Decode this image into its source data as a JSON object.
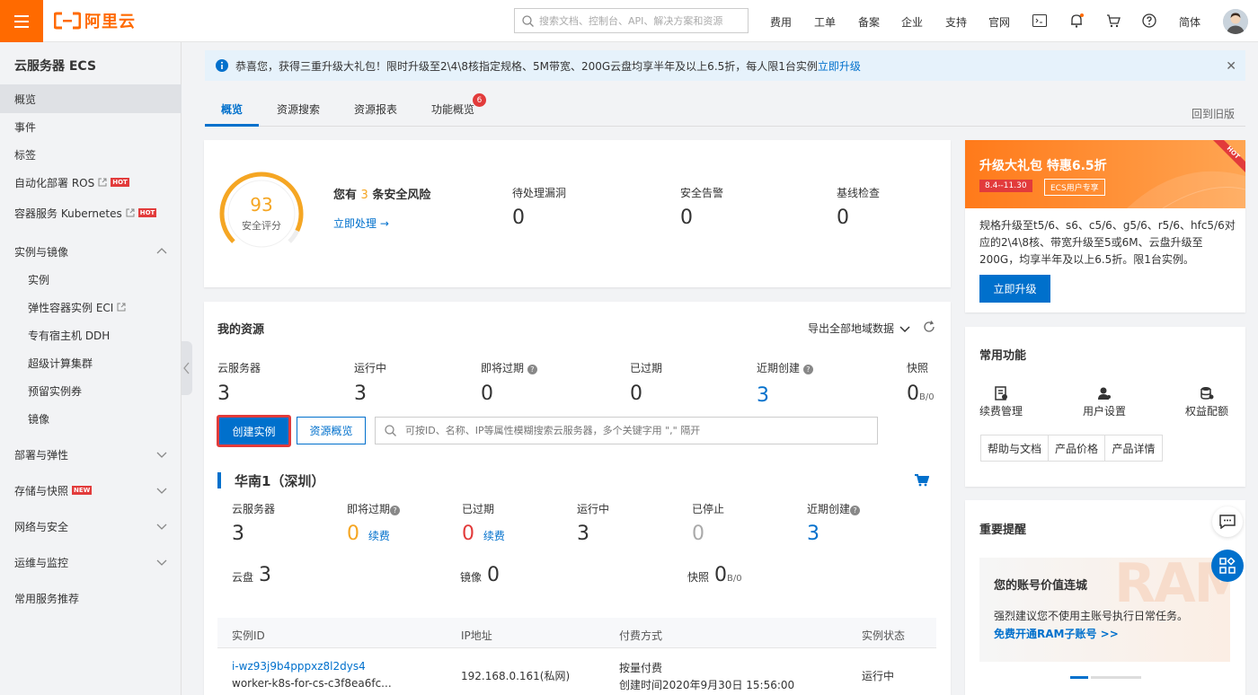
{
  "header": {
    "brand": "阿里云",
    "search_placeholder": "搜索文档、控制台、API、解决方案和资源",
    "links": [
      "费用",
      "工单",
      "备案",
      "企业",
      "支持",
      "官网"
    ],
    "lang": "简体"
  },
  "sidebar": {
    "title": "云服务器 ECS",
    "items": [
      {
        "label": "概览"
      },
      {
        "label": "事件"
      },
      {
        "label": "标签"
      },
      {
        "label": "自动化部署 ROS",
        "badge": "HOT"
      },
      {
        "label": "容器服务 Kubernetes",
        "badge": "HOT"
      },
      {
        "label": "实例与镜像"
      },
      {
        "label": "实例"
      },
      {
        "label": "弹性容器实例 ECI"
      },
      {
        "label": "专有宿主机 DDH"
      },
      {
        "label": "超级计算集群"
      },
      {
        "label": "预留实例券"
      },
      {
        "label": "镜像"
      },
      {
        "label": "部署与弹性"
      },
      {
        "label": "存储与快照",
        "badge": "NEW"
      },
      {
        "label": "网络与安全"
      },
      {
        "label": "运维与监控"
      },
      {
        "label": "常用服务推荐"
      }
    ]
  },
  "notice": {
    "text": "恭喜您，获得三重升级大礼包！限时升级至2\\4\\8核指定规格、5M带宽、200G云盘均享半年及以上6.5折，每人限1台实例",
    "link": "立即升级"
  },
  "tabs": {
    "items": [
      "概览",
      "资源搜索",
      "资源报表",
      "功能概览"
    ],
    "badge": "6",
    "old_version": "回到旧版"
  },
  "security": {
    "score": "93",
    "score_label": "安全评分",
    "risk_prefix": "您有",
    "risk_count": "3",
    "risk_suffix": "条安全风险",
    "action": "立即处理 →",
    "stats": [
      {
        "label": "待处理漏洞",
        "value": "0"
      },
      {
        "label": "安全告警",
        "value": "0"
      },
      {
        "label": "基线检查",
        "value": "0"
      }
    ]
  },
  "resources": {
    "title": "我的资源",
    "export": "导出全部地域数据",
    "stats": [
      {
        "label": "云服务器",
        "value": "3"
      },
      {
        "label": "运行中",
        "value": "3"
      },
      {
        "label": "即将过期",
        "value": "0"
      },
      {
        "label": "已过期",
        "value": "0"
      },
      {
        "label": "近期创建",
        "value": "3"
      },
      {
        "label": "快照",
        "value": "0",
        "unit": "B/0"
      }
    ],
    "create_btn": "创建实例",
    "overview_btn": "资源概览",
    "filter_placeholder": "可按ID、名称、IP等属性模糊搜索云服务器，多个关键字用 \",\" 隔开"
  },
  "region": {
    "name": "华南1（深圳）",
    "stats": [
      {
        "label": "云服务器",
        "value": "3"
      },
      {
        "label": "即将过期",
        "value": "0",
        "renew": "续费"
      },
      {
        "label": "已过期",
        "value": "0",
        "renew": "续费"
      },
      {
        "label": "运行中",
        "value": "3"
      },
      {
        "label": "已停止",
        "value": "0"
      },
      {
        "label": "近期创建",
        "value": "3"
      }
    ],
    "disk_label": "云盘",
    "disk_value": "3",
    "image_label": "镜像",
    "image_value": "0",
    "snap_label": "快照",
    "snap_value": "0",
    "snap_unit": "B/0"
  },
  "table": {
    "headers": [
      "实例ID",
      "IP地址",
      "付费方式",
      "实例状态"
    ],
    "rows": [
      {
        "id": "i-wz93j9b4pppxz8l2dys4",
        "name": "worker-k8s-for-cs-c3f8ea6fc...",
        "ip": "192.168.0.161(私网)",
        "billing": "按量付费",
        "created": "创建时间2020年9月30日 15:56:00",
        "status": "运行中"
      }
    ]
  },
  "promo": {
    "title": "升级大礼包 特惠6.5折",
    "date": "8.4--11.30",
    "tag": "ECS用户专享",
    "hot": "HOT",
    "desc": "规格升级至t5/6、s6、c5/6、g5/6、r5/6、hfc5/6对应的2\\4\\8核、带宽升级至5或6M、云盘升级至200G，均享半年及以上6.5折。限1台实例。",
    "button": "立即升级"
  },
  "quick": {
    "title": "常用功能",
    "tiles": [
      "续费管理",
      "用户设置",
      "权益配额"
    ],
    "buttons": [
      "帮助与文档",
      "产品价格",
      "产品详情"
    ]
  },
  "reminder": {
    "title": "重要提醒",
    "card_title": "您的账号价值连城",
    "card_desc": "强烈建议您不使用主账号执行日常任务。",
    "card_link": "免费开通RAM子账号 >>",
    "watermark": "RAM"
  },
  "colors": {
    "brand": "#ff6a00",
    "primary": "#0070cc",
    "warning": "#f5a623",
    "danger": "#e23b3b"
  }
}
